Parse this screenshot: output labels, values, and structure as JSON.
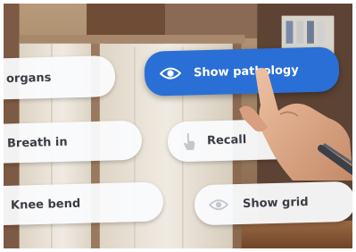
{
  "menu": {
    "items": [
      {
        "label": "organs",
        "icon": "none"
      },
      {
        "label": "Breath in",
        "icon": "none"
      },
      {
        "label": "Knee bend",
        "icon": "left-edge-icon"
      },
      {
        "label": "Show pathology",
        "icon": "eye-icon",
        "selected": true
      },
      {
        "label": "Recall",
        "icon": "hand-pointer-icon"
      },
      {
        "label": "Show grid",
        "icon": "eye-icon"
      }
    ]
  },
  "colors": {
    "active_button": "#2a6fd6",
    "button_background": "#fafbfd",
    "button_text": "#3a3d44",
    "active_text": "#ffffff",
    "icon_faded": "#c4c7cc"
  }
}
